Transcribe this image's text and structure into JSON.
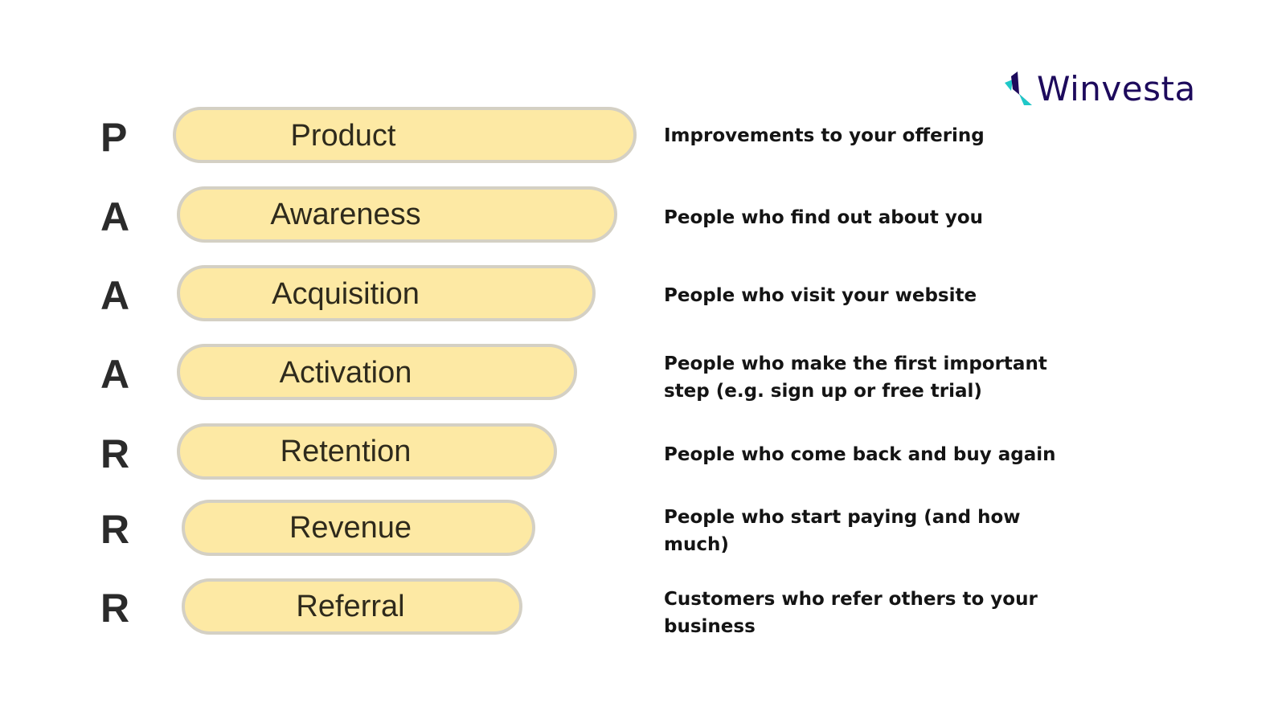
{
  "logo": {
    "text": "Winvesta",
    "colors": {
      "primary": "#1d0a5c",
      "accent": "#1fc8c8"
    }
  },
  "rows": [
    {
      "letter": "P",
      "label": "Product",
      "description": "Improvements to your offering"
    },
    {
      "letter": "A",
      "label": "Awareness",
      "description": "People who find out about you"
    },
    {
      "letter": "A",
      "label": "Acquisition",
      "description": "People who visit your website"
    },
    {
      "letter": "A",
      "label": "Activation",
      "description": "People who make the first important step (e.g. sign up or free trial)"
    },
    {
      "letter": "R",
      "label": "Retention",
      "description": "People who come back and buy again"
    },
    {
      "letter": "R",
      "label": "Revenue",
      "description": "People who start paying (and how much)"
    },
    {
      "letter": "R",
      "label": "Referral",
      "description": "Customers who refer others to your business"
    }
  ],
  "colors": {
    "pill_fill": "#fde9a4",
    "pill_border": "#d4d0c4"
  }
}
